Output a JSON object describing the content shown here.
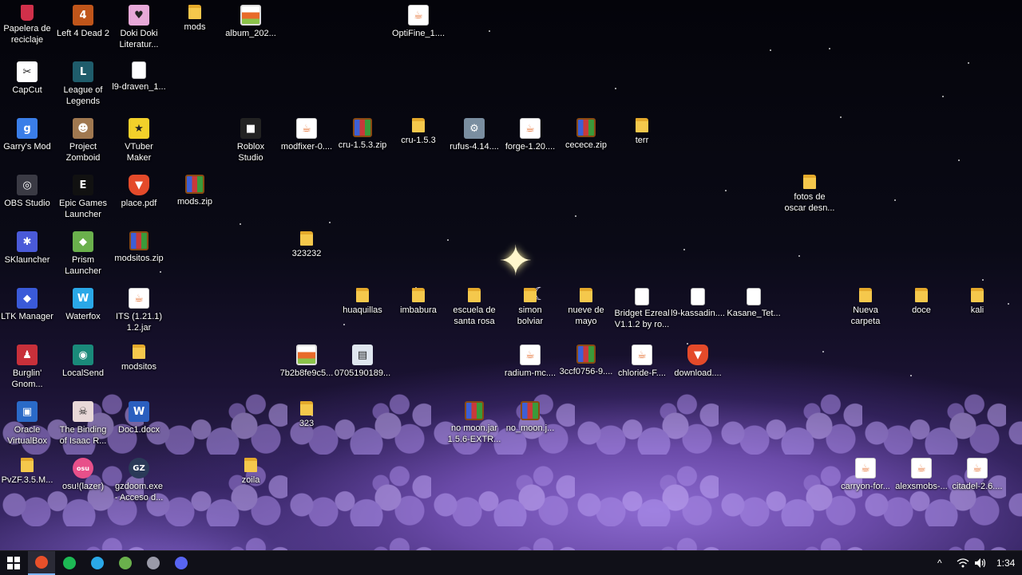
{
  "desktop": {
    "icons": [
      {
        "label": "Papelera de\nreciclaje",
        "type": "trash",
        "glyph": "",
        "color": "#d0304a",
        "name": "recycle-bin-icon"
      },
      {
        "label": "Left 4 Dead 2",
        "type": "app",
        "glyph": "4",
        "color": "#c0551a",
        "name": "left-4-dead-2-icon"
      },
      {
        "label": "Doki Doki\nLiteratur...",
        "type": "app",
        "glyph": "♥",
        "color": "#e7a8d8",
        "name": "doki-doki-icon"
      },
      {
        "label": "mods",
        "type": "folder",
        "glyph": "",
        "color": "#f5c84c",
        "name": "folder-icon"
      },
      {
        "label": "album_202...",
        "type": "img",
        "glyph": "",
        "color": "#e86a2a",
        "name": "image-file-icon"
      },
      {
        "label": "OptiFine_1....",
        "type": "java",
        "glyph": "☕",
        "color": "#e46b2a",
        "name": "java-file-icon"
      },
      {
        "label": "CapCut",
        "type": "app",
        "glyph": "✂",
        "color": "#ffffff",
        "name": "capcut-icon"
      },
      {
        "label": "League of\nLegends",
        "type": "app",
        "glyph": "L",
        "color": "#1f5c6b",
        "name": "league-of-legends-icon"
      },
      {
        "label": "l9-draven_1...",
        "type": "doc",
        "glyph": "",
        "color": "#ffffff",
        "name": "document-icon"
      },
      {
        "label": "Garry's Mod",
        "type": "app",
        "glyph": "g",
        "color": "#3a7ee8",
        "name": "garrys-mod-icon"
      },
      {
        "label": "Project\nZomboid",
        "type": "app",
        "glyph": "☻",
        "color": "#a07850",
        "name": "project-zomboid-icon"
      },
      {
        "label": "VTuber\nMaker",
        "type": "app",
        "glyph": "★",
        "color": "#f2d02a",
        "name": "vtuber-maker-icon"
      },
      {
        "label": "Roblox\nStudio",
        "type": "app",
        "glyph": "■",
        "color": "#222222",
        "name": "roblox-studio-icon"
      },
      {
        "label": "modfixer-0....",
        "type": "java",
        "glyph": "☕",
        "color": "#e46b2a",
        "name": "java-file-icon"
      },
      {
        "label": "cru-1.5.3.zip",
        "type": "zip",
        "glyph": "",
        "color": "#c83a3a",
        "name": "zip-archive-icon"
      },
      {
        "label": "cru-1.5.3",
        "type": "folder",
        "glyph": "",
        "color": "#f5c84c",
        "name": "folder-icon"
      },
      {
        "label": "rufus-4.14....",
        "type": "app",
        "glyph": "⚙",
        "color": "#7a8ea0",
        "name": "rufus-icon"
      },
      {
        "label": "forge-1.20....",
        "type": "java",
        "glyph": "☕",
        "color": "#e46b2a",
        "name": "java-file-icon"
      },
      {
        "label": "cecece.zip",
        "type": "zip",
        "glyph": "",
        "color": "#c83a3a",
        "name": "zip-archive-icon"
      },
      {
        "label": "terr",
        "type": "folder",
        "glyph": "",
        "color": "#f5c84c",
        "name": "folder-icon"
      },
      {
        "label": "OBS Studio",
        "type": "app",
        "glyph": "◎",
        "color": "#3a3a44",
        "name": "obs-studio-icon"
      },
      {
        "label": "Epic Games\nLauncher",
        "type": "app",
        "glyph": "E",
        "color": "#111111",
        "name": "epic-games-icon"
      },
      {
        "label": "place.pdf",
        "type": "pdf",
        "glyph": "▼",
        "color": "#e44a2a",
        "name": "pdf-file-icon"
      },
      {
        "label": "mods.zip",
        "type": "zip",
        "glyph": "",
        "color": "#c83a3a",
        "name": "zip-archive-icon"
      },
      {
        "label": "fotos de\noscar desn...",
        "type": "folder",
        "glyph": "",
        "color": "#f5c84c",
        "name": "folder-icon"
      },
      {
        "label": "SKlauncher",
        "type": "app",
        "glyph": "✱",
        "color": "#4a5ad8",
        "name": "sklauncher-icon"
      },
      {
        "label": "Prism\nLauncher",
        "type": "app",
        "glyph": "◆",
        "color": "#6ab04c",
        "name": "prism-launcher-icon"
      },
      {
        "label": "modsitos.zip",
        "type": "zip",
        "glyph": "",
        "color": "#c83a3a",
        "name": "zip-archive-icon"
      },
      {
        "label": "323232",
        "type": "folder",
        "glyph": "",
        "color": "#f5c84c",
        "name": "folder-icon"
      },
      {
        "label": "LTK Manager",
        "type": "app",
        "glyph": "◆",
        "color": "#3a5ad8",
        "name": "ltk-manager-icon"
      },
      {
        "label": "Waterfox",
        "type": "app",
        "glyph": "W",
        "color": "#2aa8e8",
        "name": "waterfox-icon"
      },
      {
        "label": "ITS (1.21.1)\n1.2.jar",
        "type": "java",
        "glyph": "☕",
        "color": "#e46b2a",
        "name": "java-file-icon"
      },
      {
        "label": "huaquillas",
        "type": "folder",
        "glyph": "",
        "color": "#f5c84c",
        "name": "folder-icon"
      },
      {
        "label": "imbabura",
        "type": "folder",
        "glyph": "",
        "color": "#f5c84c",
        "name": "folder-icon"
      },
      {
        "label": "escuela de\nsanta rosa",
        "type": "folder",
        "glyph": "",
        "color": "#f5c84c",
        "name": "folder-icon"
      },
      {
        "label": "simon\nbolviar",
        "type": "folder",
        "glyph": "",
        "color": "#f5c84c",
        "name": "folder-icon"
      },
      {
        "label": "nueve de\nmayo",
        "type": "folder",
        "glyph": "",
        "color": "#f5c84c",
        "name": "folder-icon"
      },
      {
        "label": "Bridget Ezreal\nV1.1.2 by ro...",
        "type": "doc",
        "glyph": "",
        "color": "#ffffff",
        "name": "document-icon"
      },
      {
        "label": "l9-kassadin....",
        "type": "doc",
        "glyph": "",
        "color": "#ffffff",
        "name": "document-icon"
      },
      {
        "label": "Kasane_Tet...",
        "type": "doc",
        "glyph": "",
        "color": "#ffffff",
        "name": "document-icon"
      },
      {
        "label": "Nueva\ncarpeta",
        "type": "folder",
        "glyph": "",
        "color": "#f5c84c",
        "name": "folder-icon"
      },
      {
        "label": "doce",
        "type": "folder",
        "glyph": "",
        "color": "#f5c84c",
        "name": "folder-icon"
      },
      {
        "label": "kali",
        "type": "folder",
        "glyph": "",
        "color": "#f5c84c",
        "name": "folder-icon"
      },
      {
        "label": "Burglin'\nGnom...",
        "type": "app",
        "glyph": "♟",
        "color": "#c8303a",
        "name": "burglin-gnomes-icon"
      },
      {
        "label": "LocalSend",
        "type": "app",
        "glyph": "◉",
        "color": "#1a8a7a",
        "name": "localsend-icon"
      },
      {
        "label": "modsitos",
        "type": "folder",
        "glyph": "",
        "color": "#f5c84c",
        "name": "folder-icon"
      },
      {
        "label": "7b2b8fe9c5...",
        "type": "img",
        "glyph": "",
        "color": "#e86a2a",
        "name": "image-file-icon"
      },
      {
        "label": "0705190189...",
        "type": "app",
        "glyph": "▤",
        "color": "#dfe6ef",
        "name": "file-icon"
      },
      {
        "label": "radium-mc....",
        "type": "java",
        "glyph": "☕",
        "color": "#e46b2a",
        "name": "java-file-icon"
      },
      {
        "label": "3ccf0756-9....",
        "type": "zip",
        "glyph": "",
        "color": "#c83a3a",
        "name": "zip-archive-icon"
      },
      {
        "label": "chloride-F....",
        "type": "java",
        "glyph": "☕",
        "color": "#e46b2a",
        "name": "java-file-icon"
      },
      {
        "label": "download....",
        "type": "pdf",
        "glyph": "▼",
        "color": "#e44a2a",
        "name": "brave-html-icon"
      },
      {
        "label": "Oracle\nVirtualBox",
        "type": "app",
        "glyph": "▣",
        "color": "#2a6ac8",
        "name": "virtualbox-icon"
      },
      {
        "label": "The Binding\nof Isaac R...",
        "type": "app",
        "glyph": "☠",
        "color": "#e8d8d8",
        "name": "binding-of-isaac-icon"
      },
      {
        "label": "Doc1.docx",
        "type": "word",
        "glyph": "W",
        "color": "#2b5fbf",
        "name": "word-document-icon"
      },
      {
        "label": "323",
        "type": "folder",
        "glyph": "",
        "color": "#f5c84c",
        "name": "folder-icon"
      },
      {
        "label": "no moon.jar\n1.5.6-EXTR...",
        "type": "zip",
        "glyph": "",
        "color": "#c83a3a",
        "name": "zip-archive-icon"
      },
      {
        "label": "no_moon.j...",
        "type": "zip",
        "glyph": "",
        "color": "#c83a3a",
        "name": "zip-archive-icon"
      },
      {
        "label": "PvZF.3.5.M...",
        "type": "folder",
        "glyph": "",
        "color": "#f5c84c",
        "name": "folder-icon"
      },
      {
        "label": "osu!(lazer)",
        "type": "app",
        "glyph": "osu",
        "color": "#e8508a",
        "name": "osu-icon"
      },
      {
        "label": "gzdoom.exe\n- Acceso d...",
        "type": "app",
        "glyph": "GZ",
        "color": "#2a3a58",
        "name": "gzdoom-icon"
      },
      {
        "label": "zoila",
        "type": "folder",
        "glyph": "",
        "color": "#f5c84c",
        "name": "folder-icon"
      },
      {
        "label": "carryon-for...",
        "type": "java",
        "glyph": "☕",
        "color": "#e46b2a",
        "name": "java-file-icon"
      },
      {
        "label": "alexsmobs-...",
        "type": "java",
        "glyph": "☕",
        "color": "#e46b2a",
        "name": "java-file-icon"
      },
      {
        "label": "citadel-2.6....",
        "type": "java",
        "glyph": "☕",
        "color": "#e46b2a",
        "name": "java-file-icon"
      }
    ]
  },
  "taskbar": {
    "start_icon": "windows-start-icon",
    "apps": [
      {
        "name": "brave-icon",
        "color": "#e8502a",
        "active": true
      },
      {
        "name": "spotify-icon",
        "color": "#1db954",
        "active": false
      },
      {
        "name": "waterfox-icon",
        "color": "#2aa8e8",
        "active": false
      },
      {
        "name": "prism-launcher-icon",
        "color": "#6ab04c",
        "active": false
      },
      {
        "name": "obs-studio-icon",
        "color": "#9a9aa8",
        "active": false
      },
      {
        "name": "discord-icon",
        "color": "#5865f2",
        "active": false
      }
    ],
    "tray": {
      "chevron": "^",
      "time": "1:34"
    }
  }
}
